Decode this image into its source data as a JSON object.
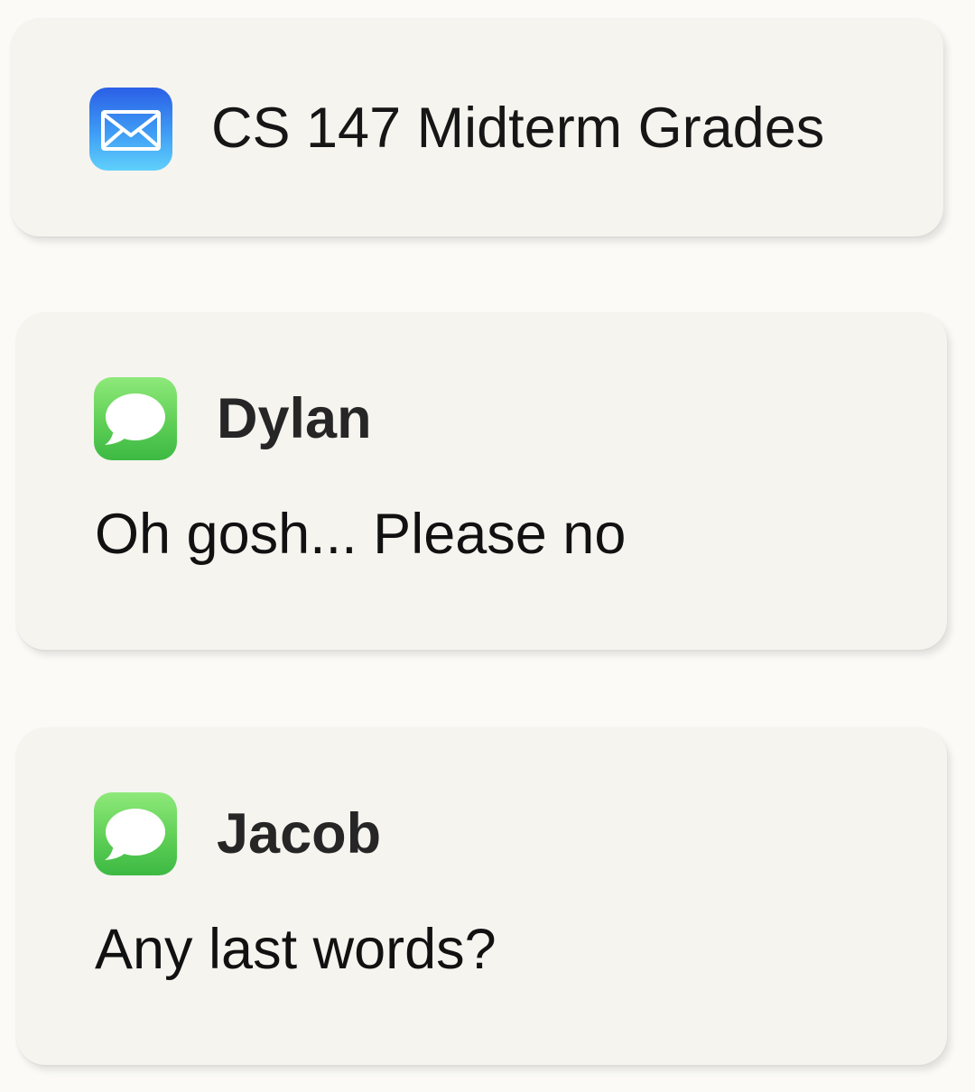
{
  "notifications": [
    {
      "app": "Mail",
      "icon": "mail-icon",
      "title": "CS 147 Midterm Grades"
    },
    {
      "app": "Messages",
      "icon": "messages-icon",
      "sender": "Dylan",
      "message": "Oh gosh... Please no"
    },
    {
      "app": "Messages",
      "icon": "messages-icon",
      "sender": "Jacob",
      "message": "Any last words?"
    }
  ],
  "colors": {
    "background": "#fbfaf7",
    "card": "#f5f4ef",
    "mail_icon_top": "#2a5fe6",
    "mail_icon_bottom": "#5fd0fb",
    "messages_icon_top": "#8ee97a",
    "messages_icon_bottom": "#3cb943"
  }
}
